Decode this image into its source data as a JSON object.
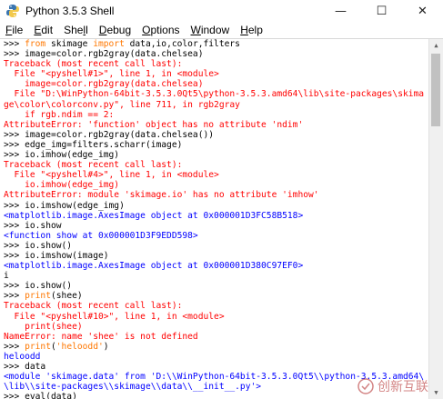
{
  "window": {
    "title": "Python 3.5.3 Shell",
    "minimize": "—",
    "maximize": "☐",
    "close": "✕"
  },
  "menu": {
    "items": [
      {
        "underline": "F",
        "rest": "ile"
      },
      {
        "underline": "E",
        "rest": "dit"
      },
      {
        "prefix": "She",
        "underline": "l",
        "rest": "l"
      },
      {
        "underline": "D",
        "rest": "ebug"
      },
      {
        "underline": "O",
        "rest": "ptions"
      },
      {
        "underline": "W",
        "rest": "indow"
      },
      {
        "underline": "H",
        "rest": "elp"
      }
    ]
  },
  "shell": {
    "lines": [
      [
        {
          "t": ">>> ",
          "c": "prompt"
        },
        {
          "t": "from",
          "c": "kw"
        },
        {
          "t": " skimage ",
          "c": "prompt"
        },
        {
          "t": "import",
          "c": "kw"
        },
        {
          "t": " data,io,color,filters",
          "c": "prompt"
        }
      ],
      [
        {
          "t": ">>> image=color.rgb2gray(data.chelsea)",
          "c": "prompt"
        }
      ],
      [
        {
          "t": "Traceback (most recent call last):",
          "c": "err"
        }
      ],
      [
        {
          "t": "  File \"<pyshell#1>\", line 1, in <module>",
          "c": "err"
        }
      ],
      [
        {
          "t": "    image=color.rgb2gray(data.chelsea)",
          "c": "err"
        }
      ],
      [
        {
          "t": "  File \"D:\\WinPython-64bit-3.5.3.0Qt5\\python-3.5.3.amd64\\lib\\site-packages\\skima",
          "c": "err"
        }
      ],
      [
        {
          "t": "ge\\color\\colorconv.py\", line 711, in rgb2gray",
          "c": "err"
        }
      ],
      [
        {
          "t": "    if rgb.ndim == 2:",
          "c": "err"
        }
      ],
      [
        {
          "t": "AttributeError: 'function' object has no attribute 'ndim'",
          "c": "err"
        }
      ],
      [
        {
          "t": ">>> image=color.rgb2gray(data.chelsea())",
          "c": "prompt"
        }
      ],
      [
        {
          "t": ">>> edge_img=filters.scharr(image)",
          "c": "prompt"
        }
      ],
      [
        {
          "t": ">>> io.imhow(edge_img)",
          "c": "prompt"
        }
      ],
      [
        {
          "t": "Traceback (most recent call last):",
          "c": "err"
        }
      ],
      [
        {
          "t": "  File \"<pyshell#4>\", line 1, in <module>",
          "c": "err"
        }
      ],
      [
        {
          "t": "    io.imhow(edge_img)",
          "c": "err"
        }
      ],
      [
        {
          "t": "AttributeError: module 'skimage.io' has no attribute 'imhow'",
          "c": "err"
        }
      ],
      [
        {
          "t": ">>> io.imshow(edge_img)",
          "c": "prompt"
        }
      ],
      [
        {
          "t": "<matplotlib.image.AxesImage object at 0x000001D3FC58B518>",
          "c": "out"
        }
      ],
      [
        {
          "t": ">>> io.show",
          "c": "prompt"
        }
      ],
      [
        {
          "t": "<function show at 0x000001D3F9EDD598>",
          "c": "out"
        }
      ],
      [
        {
          "t": ">>> io.show()",
          "c": "prompt"
        }
      ],
      [
        {
          "t": ">>> io.imshow(image)",
          "c": "prompt"
        }
      ],
      [
        {
          "t": "<matplotlib.image.AxesImage object at 0x000001D380C97EF0>",
          "c": "out"
        }
      ],
      [
        {
          "t": "i",
          "c": "prompt"
        }
      ],
      [
        {
          "t": ">>> io.show()",
          "c": "prompt"
        }
      ],
      [
        {
          "t": ">>> ",
          "c": "prompt"
        },
        {
          "t": "print",
          "c": "kw"
        },
        {
          "t": "(shee)",
          "c": "prompt"
        }
      ],
      [
        {
          "t": "Traceback (most recent call last):",
          "c": "err"
        }
      ],
      [
        {
          "t": "  File \"<pyshell#10>\", line 1, in <module>",
          "c": "err"
        }
      ],
      [
        {
          "t": "    print(shee)",
          "c": "err"
        }
      ],
      [
        {
          "t": "NameError: name 'shee' is not defined",
          "c": "err"
        }
      ],
      [
        {
          "t": ">>> ",
          "c": "prompt"
        },
        {
          "t": "print",
          "c": "kw"
        },
        {
          "t": "(",
          "c": "prompt"
        },
        {
          "t": "'heloodd'",
          "c": "kw"
        },
        {
          "t": ")",
          "c": "prompt"
        }
      ],
      [
        {
          "t": "heloodd",
          "c": "out"
        }
      ],
      [
        {
          "t": ">>> data",
          "c": "prompt"
        }
      ],
      [
        {
          "t": "<module 'skimage.data' from 'D:\\\\WinPython-64bit-3.5.3.0Qt5\\\\python-3.5.3.amd64\\",
          "c": "out"
        }
      ],
      [
        {
          "t": "\\lib\\\\site-packages\\\\skimage\\\\data\\\\__init__.py'>",
          "c": "out"
        }
      ],
      [
        {
          "t": ">>> eval(data)",
          "c": "prompt"
        }
      ],
      [
        {
          "t": "Traceback (most recent call last):",
          "c": "err"
        }
      ]
    ]
  },
  "watermark": {
    "text": "创新互联"
  }
}
